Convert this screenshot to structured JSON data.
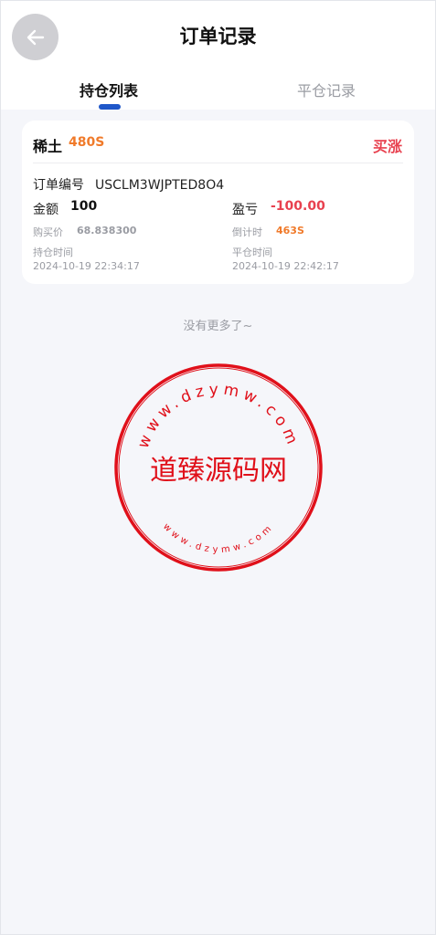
{
  "header": {
    "title": "订单记录",
    "back_icon": "arrow-left-icon"
  },
  "tabs": [
    {
      "label": "持仓列表",
      "active": true
    },
    {
      "label": "平仓记录",
      "active": false
    }
  ],
  "order": {
    "symbol": "稀土",
    "duration": "480S",
    "direction": "买涨",
    "order_no_label": "订单编号",
    "order_no": "USCLM3WJPTED8O4",
    "amount_label": "金额",
    "amount": "100",
    "pl_label": "盈亏",
    "pl": "-100.00",
    "buy_price_label": "购买价",
    "buy_price": "68.838300",
    "countdown_label": "倒计时",
    "countdown": "463S",
    "open_time_label": "持仓时间",
    "open_time": "2024-10-19 22:34:17",
    "close_time_label": "平仓时间",
    "close_time": "2024-10-19 22:42:17"
  },
  "no_more_text": "没有更多了~",
  "watermark": {
    "main": "道臻源码网",
    "domain": "www.dzymw.com"
  },
  "colors": {
    "accent": "#1f57c9",
    "up": "#e8414f",
    "orange": "#f07a2a",
    "stamp": "#e0101a"
  }
}
